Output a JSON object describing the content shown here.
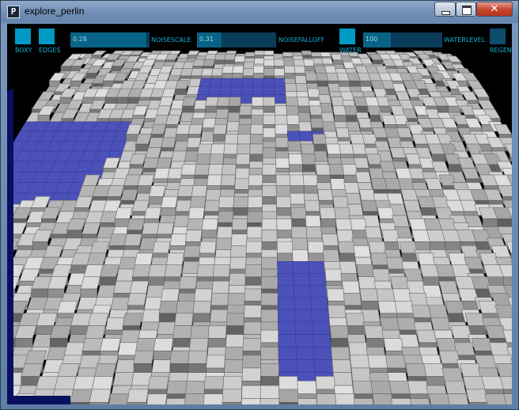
{
  "window": {
    "title": "explore_perlin",
    "app_icon_glyph": "P",
    "controls": [
      "minimize",
      "maximize",
      "close"
    ],
    "close_glyph": "✕"
  },
  "controls": {
    "toggles": [
      {
        "id": "boxy",
        "label": "BOXY",
        "on": true
      },
      {
        "id": "edges",
        "label": "EDGES",
        "on": true
      },
      {
        "id": "water",
        "label": "WATER",
        "on": true
      },
      {
        "id": "regen",
        "label": "REGEN",
        "on": false
      }
    ],
    "sliders": [
      {
        "id": "noisescale",
        "label": "NOISESCALE",
        "value": "0.28",
        "fill": 0.96
      },
      {
        "id": "noisefalloff",
        "label": "NOISEFALLOFF",
        "value": "0.31",
        "fill": 0.31
      },
      {
        "id": "waterlevel",
        "label": "WATERLEVEL",
        "value": "100",
        "fill": 0.35
      }
    ]
  },
  "scene": {
    "description_icon": "voxel-terrain",
    "colors": {
      "block": "#bdbdbd",
      "water": "#4a4fb5",
      "background": "#000000",
      "edge": "#5a5a5a"
    }
  }
}
